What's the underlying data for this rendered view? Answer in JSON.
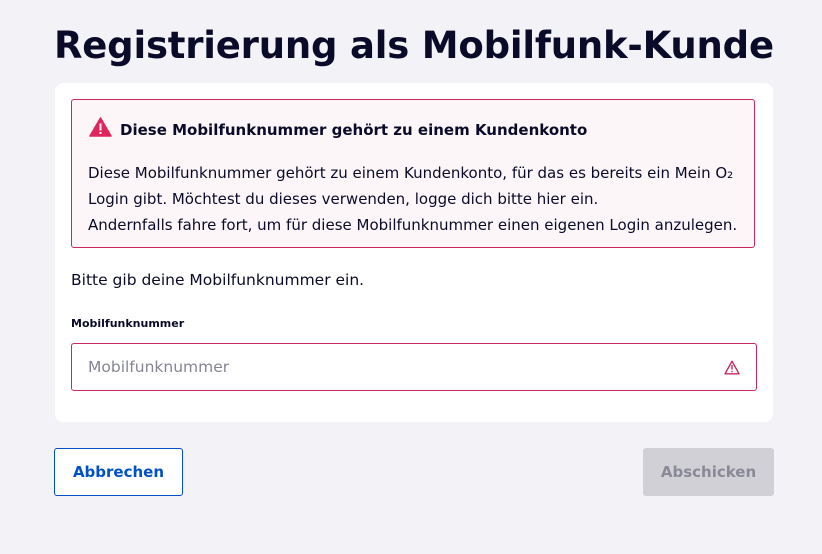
{
  "page": {
    "title": "Registrierung als Mobilfunk-Kunde"
  },
  "alert": {
    "icon": "warning-triangle-icon",
    "title": "Diese Mobilfunknummer gehört zu einem Kundenkonto",
    "lines": [
      "Diese Mobilfunknummer gehört zu einem Kundenkonto, für das es bereits ein Mein O₂",
      "Login gibt. Möchtest du dieses verwenden, logge dich bitte hier ein.",
      "Andernfalls fahre fort, um für diese Mobilfunknummer einen eigenen Login anzulegen."
    ]
  },
  "form": {
    "prompt": "Bitte gib deine Mobilfunknummer ein.",
    "phone_label": "Mobilfunknummer",
    "phone_placeholder": "Mobilfunknummer",
    "phone_value": "",
    "error_icon": "warning-triangle-outline-icon"
  },
  "actions": {
    "cancel_label": "Abbrechen",
    "submit_label": "Abschicken"
  },
  "colors": {
    "error": "#c8275f",
    "primary": "#0050c8",
    "text": "#0a0b29",
    "background": "#f2f2f7",
    "disabled_button": "#d0d0d6"
  }
}
